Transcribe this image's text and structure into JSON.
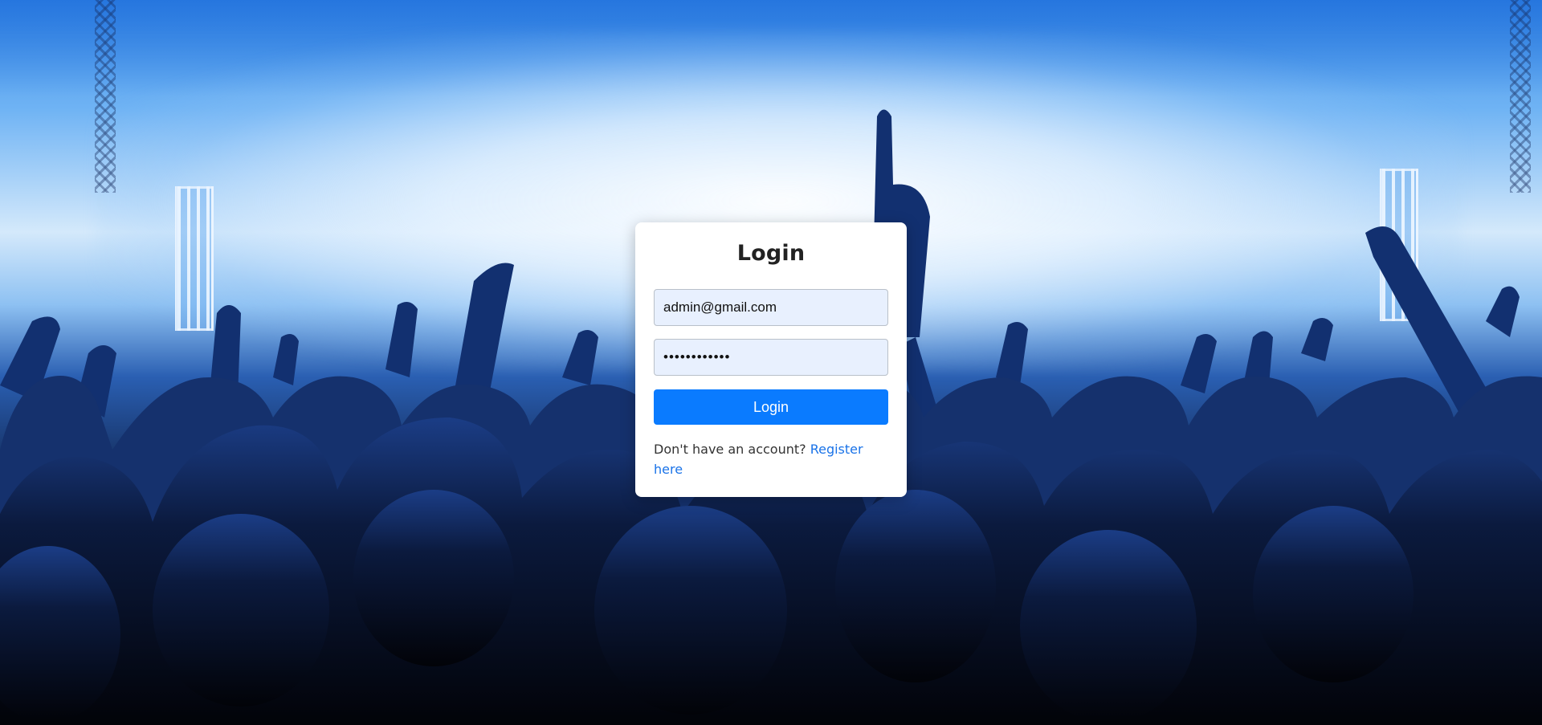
{
  "background": {
    "scene": "concert-crowd",
    "accent_color": "#3f8fe6"
  },
  "login_card": {
    "title": "Login",
    "email_value": "admin@gmail.com",
    "password_value": "••••••••••••",
    "login_button_label": "Login",
    "register_prompt": "Don't have an account? ",
    "register_link": "Register here",
    "button_color": "#0a7bff",
    "link_color": "#1a73e8"
  }
}
